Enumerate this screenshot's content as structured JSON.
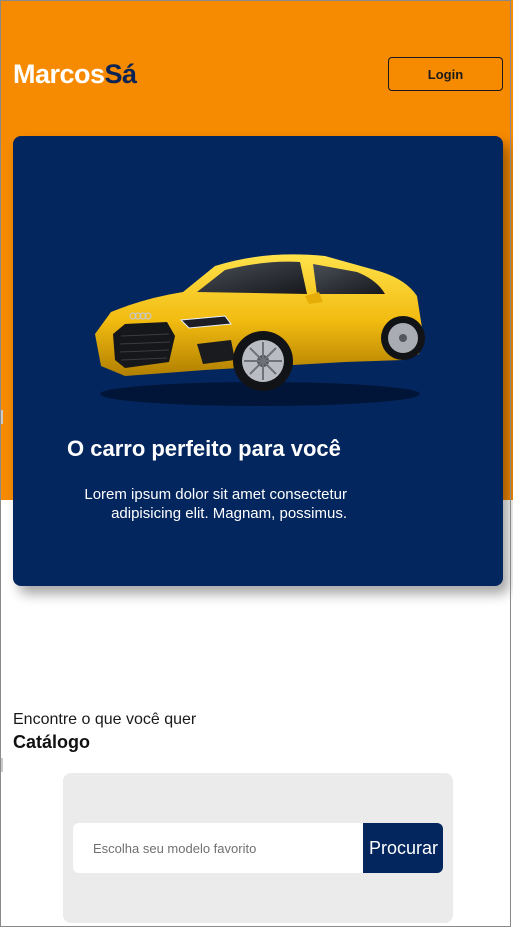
{
  "header": {
    "logo_part1": "Marcos",
    "logo_part2": "Sá",
    "login_label": "Login"
  },
  "hero": {
    "title": "O carro perfeito para você",
    "description": "Lorem ipsum dolor sit amet consectetur adipisicing elit. Magnam, possimus.",
    "image": "car-image"
  },
  "catalog": {
    "subtitle": "Encontre o que você quer",
    "title": "Catálogo",
    "search": {
      "placeholder": "Escolha seu modelo favorito",
      "value": "",
      "button_label": "Procurar"
    }
  },
  "colors": {
    "accent_orange": "#f68a00",
    "navy": "#04265e",
    "search_panel": "#ebebeb"
  }
}
